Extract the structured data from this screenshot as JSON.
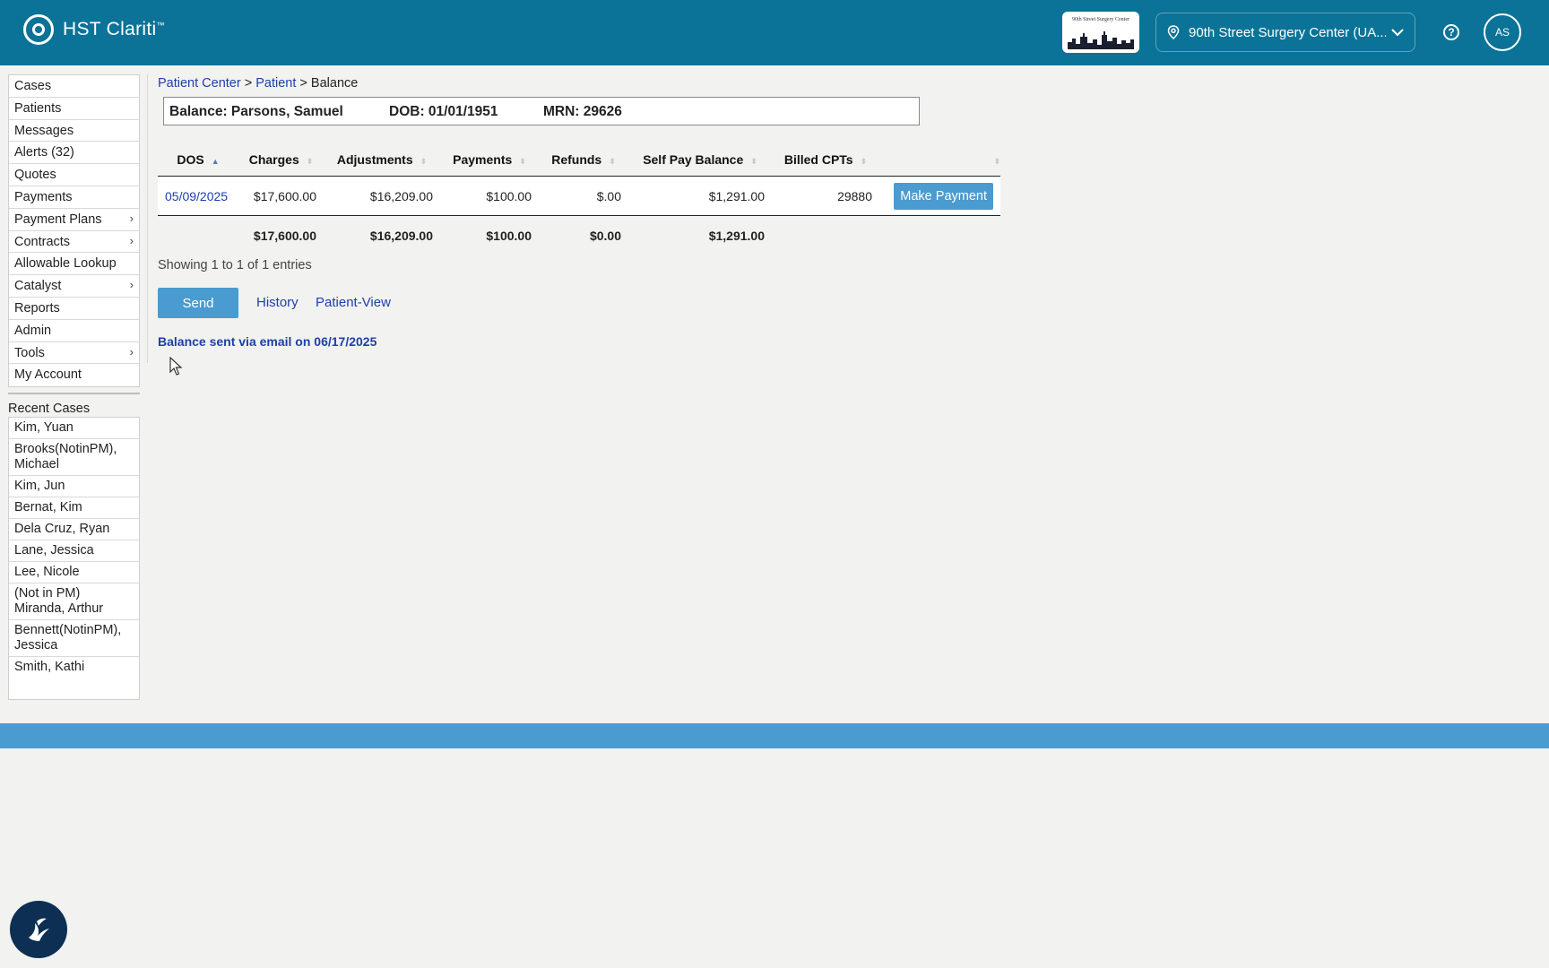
{
  "header": {
    "brand_text": "HST Clariti",
    "brand_tm": "™",
    "facility_logo_text": "90th Street Surgery Center",
    "location_label": "90th Street Surgery Center (UA...",
    "avatar_initials": "AS",
    "colors": {
      "bar": "#0b7397",
      "accent": "#4a9bcf",
      "link": "#1f3fa8"
    }
  },
  "sidebar": {
    "items": [
      {
        "label": "Cases",
        "submenu": false
      },
      {
        "label": "Patients",
        "submenu": false
      },
      {
        "label": "Messages",
        "submenu": false
      },
      {
        "label": "Alerts (32)",
        "submenu": false
      },
      {
        "label": "Quotes",
        "submenu": false
      },
      {
        "label": "Payments",
        "submenu": false
      },
      {
        "label": "Payment Plans",
        "submenu": true
      },
      {
        "label": "Contracts",
        "submenu": true
      },
      {
        "label": "Allowable Lookup",
        "submenu": false
      },
      {
        "label": "Catalyst",
        "submenu": true
      },
      {
        "label": "Reports",
        "submenu": false
      },
      {
        "label": "Admin",
        "submenu": false
      },
      {
        "label": "Tools",
        "submenu": true
      },
      {
        "label": "My Account",
        "submenu": false
      }
    ],
    "submenu_arrow": "›",
    "recent_title": "Recent Cases",
    "recent": [
      "Kim, Yuan",
      "Brooks(NotinPM), Michael",
      "Kim, Jun",
      "Bernat, Kim",
      "Dela Cruz, Ryan",
      "Lane, Jessica",
      "Lee, Nicole",
      "(Not in PM) Miranda, Arthur",
      "Bennett(NotinPM), Jessica",
      "Smith, Kathi"
    ]
  },
  "breadcrumb": {
    "part1": "Patient Center",
    "sep": " > ",
    "part2": "Patient",
    "current": "Balance"
  },
  "patient": {
    "name": "Balance: Parsons, Samuel",
    "dob": "DOB: 01/01/1951",
    "mrn": "MRN: 29626"
  },
  "table": {
    "columns": [
      "DOS",
      "Charges",
      "Adjustments",
      "Payments",
      "Refunds",
      "Self Pay Balance",
      "Billed CPTs",
      ""
    ],
    "row": {
      "dos": "05/09/2025",
      "charges": "$17,600.00",
      "adjustments": "$16,209.00",
      "payments": "$100.00",
      "refunds": "$.00",
      "self_pay_balance": "$1,291.00",
      "billed_cpts": "29880",
      "action": "Make Payment"
    },
    "totals": {
      "charges": "$17,600.00",
      "adjustments": "$16,209.00",
      "payments": "$100.00",
      "refunds": "$0.00",
      "self_pay_balance": "$1,291.00"
    }
  },
  "entries_info": "Showing 1 to 1 of 1 entries",
  "actions": {
    "send": "Send",
    "history": "History",
    "patient_view": "Patient-View"
  },
  "status_message": "Balance sent via email on 06/17/2025"
}
